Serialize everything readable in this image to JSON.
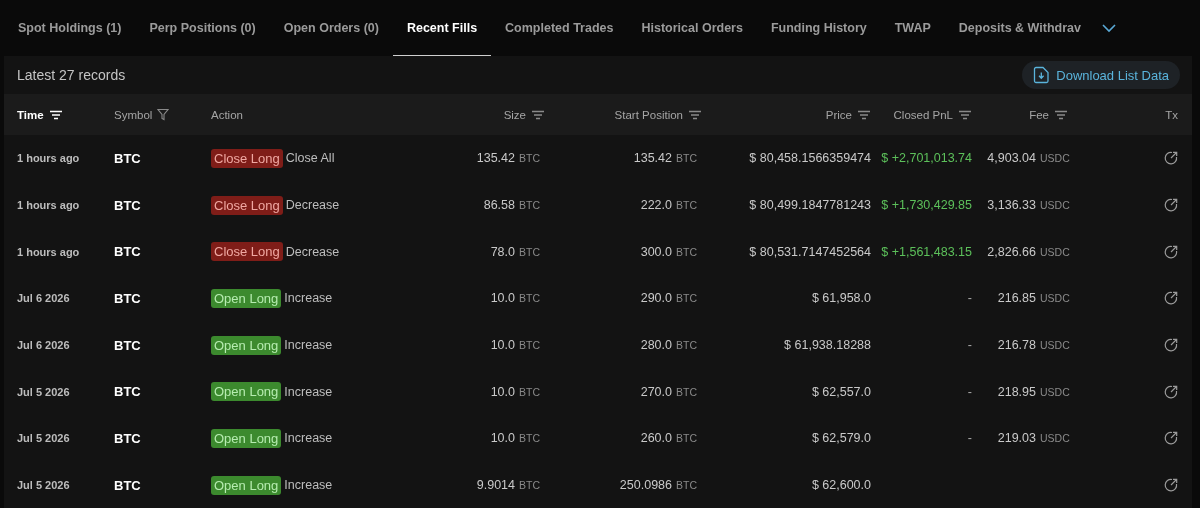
{
  "tabs": [
    {
      "label": "Spot Holdings (1)",
      "selected": false
    },
    {
      "label": "Perp Positions (0)",
      "selected": false
    },
    {
      "label": "Open Orders (0)",
      "selected": false
    },
    {
      "label": "Recent Fills",
      "selected": true
    },
    {
      "label": "Completed Trades",
      "selected": false
    },
    {
      "label": "Historical Orders",
      "selected": false
    },
    {
      "label": "Funding History",
      "selected": false
    },
    {
      "label": "TWAP",
      "selected": false
    },
    {
      "label": "Deposits & Withdrav",
      "selected": false
    }
  ],
  "records_label": "Latest 27 records",
  "download_button": "Download List Data",
  "columns": [
    {
      "label": "Time",
      "kind": "sort",
      "active": true
    },
    {
      "label": "Symbol",
      "kind": "filter",
      "active": false
    },
    {
      "label": "Action",
      "kind": "plain",
      "active": false
    },
    {
      "label": "Size",
      "kind": "sort",
      "active": false
    },
    {
      "label": "Start Position",
      "kind": "sort",
      "active": false
    },
    {
      "label": "Price",
      "kind": "sort",
      "active": false
    },
    {
      "label": "Closed PnL",
      "kind": "sort",
      "active": false
    },
    {
      "label": "Fee",
      "kind": "sort",
      "active": false
    },
    {
      "label": "Tx",
      "kind": "plain",
      "active": false
    }
  ],
  "rows": [
    {
      "time": "1 hours ago",
      "symbol": "BTC",
      "action": {
        "label": "Close Long",
        "kind": "close"
      },
      "detail": "Close All",
      "size": "135.42",
      "size_unit": "BTC",
      "start": "135.42",
      "start_unit": "BTC",
      "price": "$ 80,458.1566359474",
      "pnl": {
        "text": "$ +2,701,013.74",
        "kind": "gain"
      },
      "fee": "4,903.04",
      "fee_unit": "USDC"
    },
    {
      "time": "1 hours ago",
      "symbol": "BTC",
      "action": {
        "label": "Close Long",
        "kind": "close"
      },
      "detail": "Decrease",
      "size": "86.58",
      "size_unit": "BTC",
      "start": "222.0",
      "start_unit": "BTC",
      "price": "$ 80,499.1847781243",
      "pnl": {
        "text": "$ +1,730,429.85",
        "kind": "gain"
      },
      "fee": "3,136.33",
      "fee_unit": "USDC"
    },
    {
      "time": "1 hours ago",
      "symbol": "BTC",
      "action": {
        "label": "Close Long",
        "kind": "close"
      },
      "detail": "Decrease",
      "size": "78.0",
      "size_unit": "BTC",
      "start": "300.0",
      "start_unit": "BTC",
      "price": "$ 80,531.7147452564",
      "pnl": {
        "text": "$ +1,561,483.15",
        "kind": "gain"
      },
      "fee": "2,826.66",
      "fee_unit": "USDC"
    },
    {
      "time": "Jul 6 2026",
      "symbol": "BTC",
      "action": {
        "label": "Open Long",
        "kind": "open"
      },
      "detail": "Increase",
      "size": "10.0",
      "size_unit": "BTC",
      "start": "290.0",
      "start_unit": "BTC",
      "price": "$ 61,958.0",
      "pnl": {
        "text": "-",
        "kind": "none"
      },
      "fee": "216.85",
      "fee_unit": "USDC"
    },
    {
      "time": "Jul 6 2026",
      "symbol": "BTC",
      "action": {
        "label": "Open Long",
        "kind": "open"
      },
      "detail": "Increase",
      "size": "10.0",
      "size_unit": "BTC",
      "start": "280.0",
      "start_unit": "BTC",
      "price": "$ 61,938.18288",
      "pnl": {
        "text": "-",
        "kind": "none"
      },
      "fee": "216.78",
      "fee_unit": "USDC"
    },
    {
      "time": "Jul 5 2026",
      "symbol": "BTC",
      "action": {
        "label": "Open Long",
        "kind": "open"
      },
      "detail": "Increase",
      "size": "10.0",
      "size_unit": "BTC",
      "start": "270.0",
      "start_unit": "BTC",
      "price": "$ 62,557.0",
      "pnl": {
        "text": "-",
        "kind": "none"
      },
      "fee": "218.95",
      "fee_unit": "USDC"
    },
    {
      "time": "Jul 5 2026",
      "symbol": "BTC",
      "action": {
        "label": "Open Long",
        "kind": "open"
      },
      "detail": "Increase",
      "size": "10.0",
      "size_unit": "BTC",
      "start": "260.0",
      "start_unit": "BTC",
      "price": "$ 62,579.0",
      "pnl": {
        "text": "-",
        "kind": "none"
      },
      "fee": "219.03",
      "fee_unit": "USDC"
    },
    {
      "time": "Jul 5 2026",
      "symbol": "BTC",
      "action": {
        "label": "Open Long",
        "kind": "open"
      },
      "detail": "Increase",
      "size": "9.9014",
      "size_unit": "BTC",
      "start": "250.0986",
      "start_unit": "BTC",
      "price": "$ 62,600.0"
    }
  ]
}
